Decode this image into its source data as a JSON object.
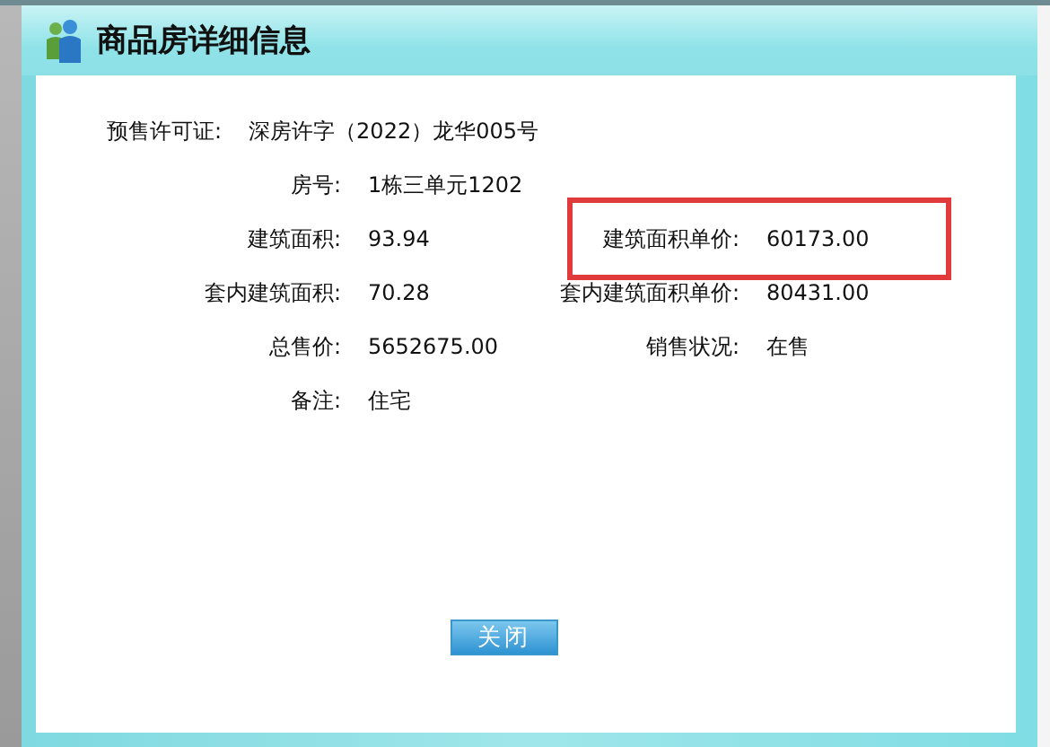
{
  "dialog": {
    "title": "商品房详细信息"
  },
  "rows": [
    [
      {
        "label": "预售许可证:",
        "value": "深房许字（2022）龙华005号",
        "highlighted": false
      }
    ],
    [
      {
        "label": "房号:",
        "value": "1栋三单元1202",
        "highlighted": false
      }
    ],
    [
      {
        "label": "建筑面积:",
        "value": "93.94",
        "highlighted": false
      },
      {
        "label": "建筑面积单价:",
        "value": "60173.00",
        "highlighted": true
      }
    ],
    [
      {
        "label": "套内建筑面积:",
        "value": "70.28",
        "highlighted": false
      },
      {
        "label": "套内建筑面积单价:",
        "value": "80431.00",
        "highlighted": false
      }
    ],
    [
      {
        "label": "总售价:",
        "value": "5652675.00",
        "highlighted": false
      },
      {
        "label": "销售状况:",
        "value": "在售",
        "highlighted": false
      }
    ],
    [
      {
        "label": "备注:",
        "value": "住宅",
        "highlighted": false
      }
    ]
  ],
  "buttons": [
    {
      "label": "关闭"
    }
  ]
}
